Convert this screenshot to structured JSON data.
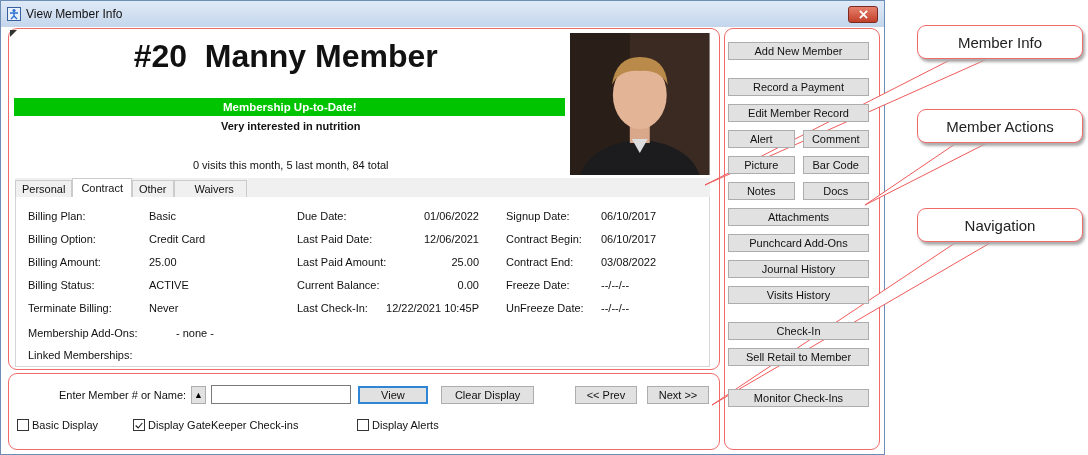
{
  "window": {
    "title": "View Member Info"
  },
  "member": {
    "heading": "#20  Manny Member",
    "status": "Membership Up-to-Date!",
    "note": "Very interested in nutrition",
    "visits": "0 visits this month, 5 last month, 84 total"
  },
  "tabs": [
    {
      "label": "Personal",
      "selected": false
    },
    {
      "label": "Contract",
      "selected": true
    },
    {
      "label": "Other",
      "selected": false
    },
    {
      "label": "Waivers",
      "selected": false
    }
  ],
  "contract": {
    "rows": [
      [
        {
          "label": "Billing Plan:",
          "value": "Basic"
        },
        {
          "label": "Due Date:",
          "value": "01/06/2022"
        },
        {
          "label": "Signup Date:",
          "value": "06/10/2017"
        }
      ],
      [
        {
          "label": "Billing Option:",
          "value": "Credit Card"
        },
        {
          "label": "Last Paid Date:",
          "value": "12/06/2021"
        },
        {
          "label": "Contract Begin:",
          "value": "06/10/2017"
        }
      ],
      [
        {
          "label": "Billing Amount:",
          "value": "25.00"
        },
        {
          "label": "Last Paid Amount:",
          "value": "25.00"
        },
        {
          "label": "Contract End:",
          "value": "03/08/2022"
        }
      ],
      [
        {
          "label": "Billing Status:",
          "value": "ACTIVE"
        },
        {
          "label": "Current Balance:",
          "value": "0.00"
        },
        {
          "label": "Freeze Date:",
          "value": "--/--/--"
        }
      ],
      [
        {
          "label": "Terminate Billing:",
          "value": "Never"
        },
        {
          "label": "Last Check-In:",
          "value": "12/22/2021 10:45P"
        },
        {
          "label": "UnFreeze Date:",
          "value": "--/--/--"
        }
      ]
    ],
    "extra": [
      {
        "label": "Membership Add-Ons:",
        "value": "- none -"
      },
      {
        "label": "Linked Memberships:"
      }
    ]
  },
  "actions": [
    {
      "rows": [
        [
          "Add New Member"
        ]
      ]
    },
    {
      "rows": [
        [
          "Record a Payment"
        ],
        [
          "Edit Member Record"
        ],
        [
          "Alert",
          "Comment"
        ],
        [
          "Picture",
          "Bar Code"
        ],
        [
          "Notes",
          "Docs"
        ],
        [
          "Attachments"
        ],
        [
          "Punchcard Add-Ons"
        ],
        [
          "Journal History"
        ],
        [
          "Visits History"
        ]
      ]
    },
    {
      "rows": [
        [
          "Check-In"
        ],
        [
          "Sell Retail to Member"
        ]
      ]
    },
    {
      "rows": [
        [
          "Monitor Check-Ins"
        ]
      ]
    }
  ],
  "navigation": {
    "label": "Enter Member # or Name:",
    "lookup_button": "▲",
    "buttons": [
      {
        "label": "View",
        "default": true
      },
      {
        "label": "Clear Display",
        "default": false
      }
    ],
    "paging": [
      {
        "label": "<< Prev"
      },
      {
        "label": "Next >>"
      }
    ],
    "checkboxes": [
      {
        "label": "Basic Display",
        "checked": false
      },
      {
        "label": "Display GateKeeper Check-ins",
        "checked": true
      },
      {
        "label": "Display Alerts",
        "checked": false
      }
    ]
  },
  "callouts": [
    {
      "label": "Member Info"
    },
    {
      "label": "Member Actions"
    },
    {
      "label": "Navigation"
    }
  ]
}
